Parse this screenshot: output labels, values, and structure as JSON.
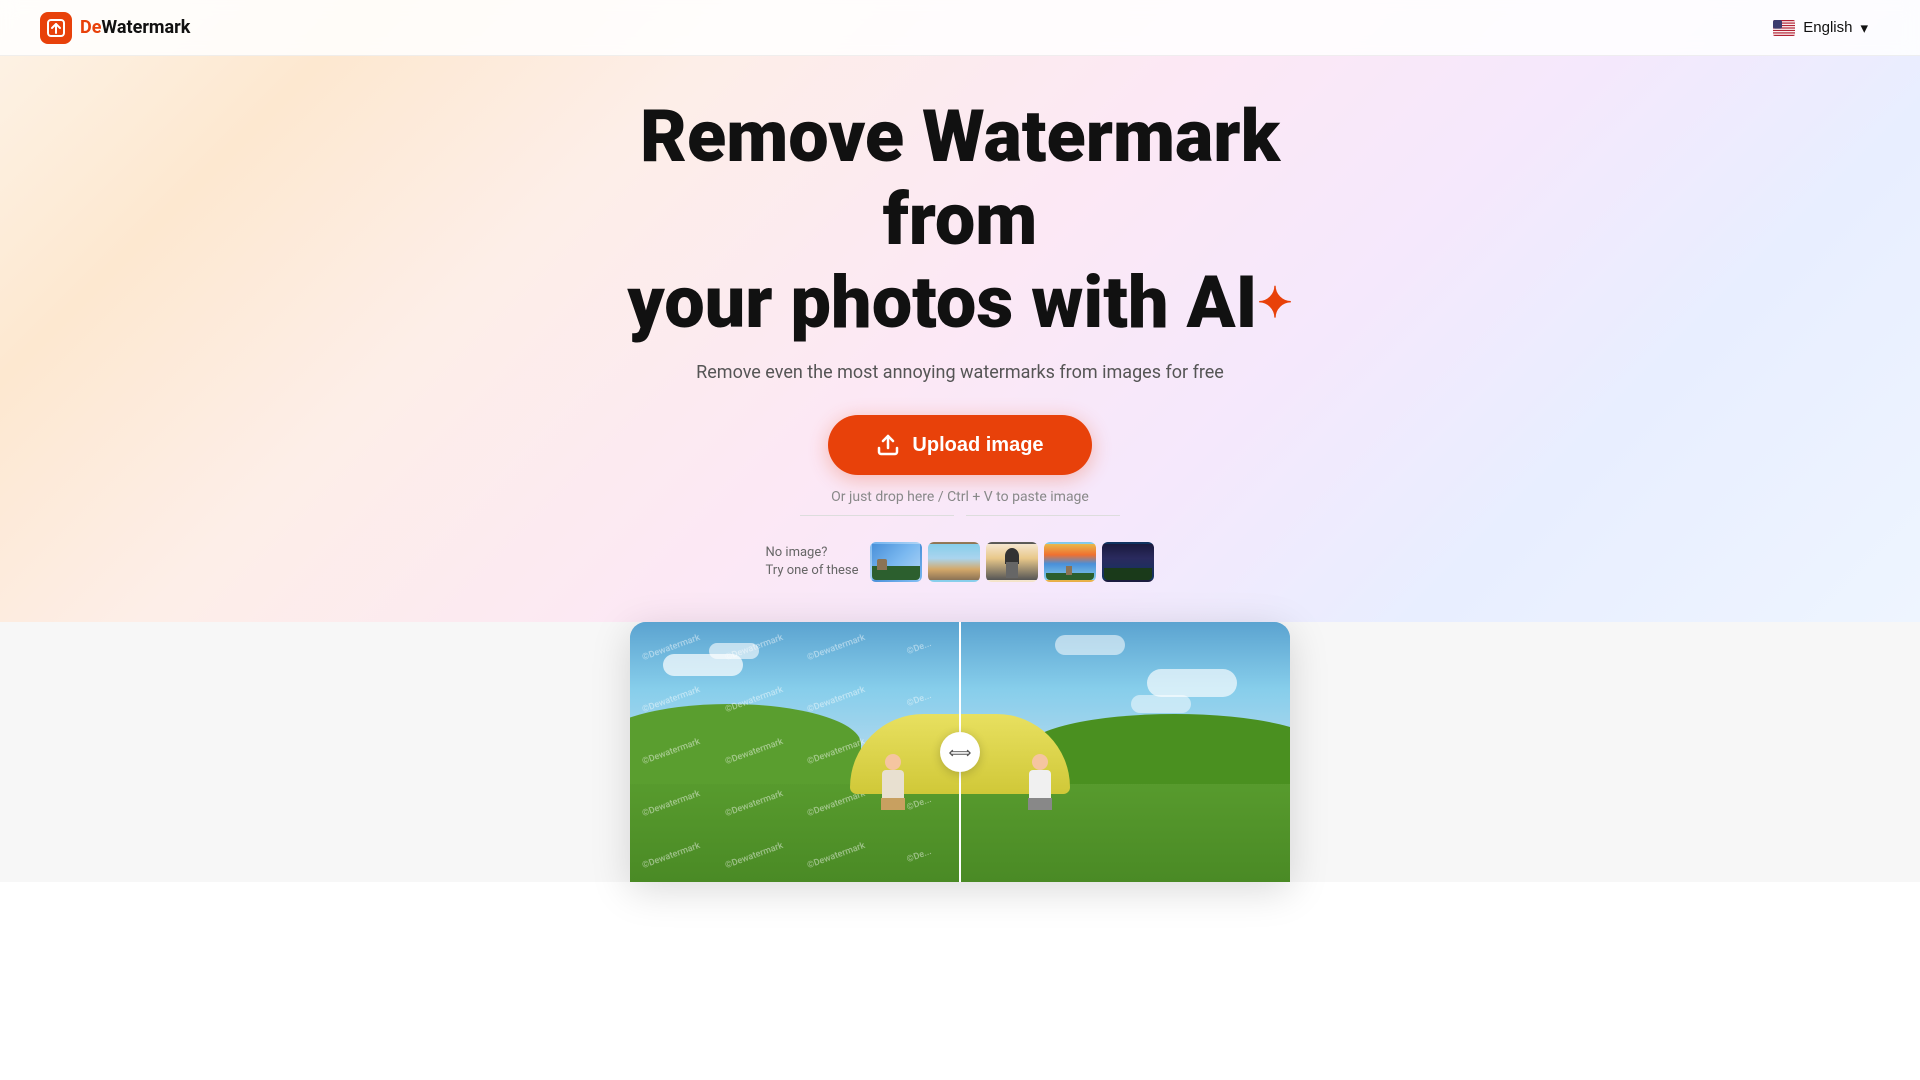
{
  "header": {
    "logo_icon": "D",
    "logo_prefix": "De",
    "logo_suffix": "Watermark",
    "lang_label": "English",
    "lang_chevron": "▾"
  },
  "hero": {
    "title_line1": "Remove Watermark from",
    "title_line2": "your photos with AI",
    "sparkle": "✦",
    "subtitle": "Remove even the most annoying watermarks from images for free",
    "upload_button": "Upload image",
    "drop_hint": "Or just drop here / Ctrl + V to paste image",
    "sample_no_image": "No image?",
    "sample_try": "Try one of these"
  },
  "demo": {
    "watermark_text": "©Dewatermark",
    "slider_arrows": "⟺"
  }
}
